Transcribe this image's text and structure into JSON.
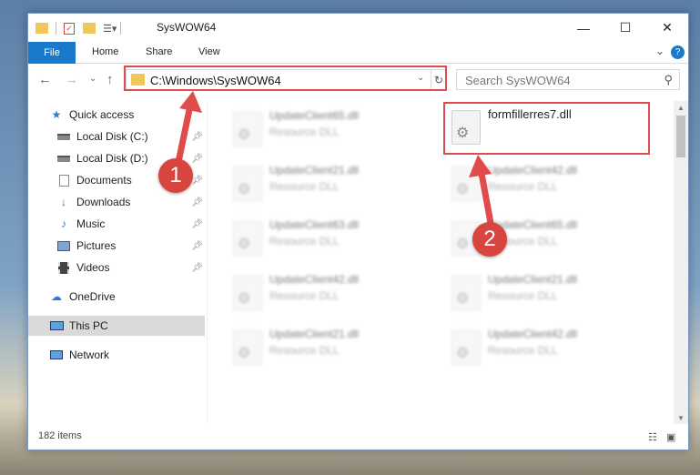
{
  "window": {
    "title": "SysWOW64",
    "minimize": "—",
    "maximize": "☐",
    "close": "✕"
  },
  "ribbon": {
    "tabs": [
      "File",
      "Home",
      "Share",
      "View"
    ],
    "expand": "⌄",
    "help": "?"
  },
  "address": {
    "path": "C:\\Windows\\SysWOW64",
    "back": "←",
    "forward": "→",
    "recent": "⌄",
    "up": "↑",
    "refresh": "↻",
    "dropdown": "⌄"
  },
  "search": {
    "placeholder": "Search SysWOW64",
    "icon": "search-icon"
  },
  "sidebar": {
    "items": [
      {
        "label": "Quick access",
        "icon": "star-icon",
        "pinned": false
      },
      {
        "label": "Local Disk (C:)",
        "icon": "drive-icon",
        "pinned": true
      },
      {
        "label": "Local Disk (D:)",
        "icon": "drive-icon",
        "pinned": true
      },
      {
        "label": "Documents",
        "icon": "documents-icon",
        "pinned": true
      },
      {
        "label": "Downloads",
        "icon": "download-icon",
        "pinned": true
      },
      {
        "label": "Music",
        "icon": "music-icon",
        "pinned": true
      },
      {
        "label": "Pictures",
        "icon": "pictures-icon",
        "pinned": true
      },
      {
        "label": "Videos",
        "icon": "videos-icon",
        "pinned": true
      },
      {
        "label": "OneDrive",
        "icon": "cloud-icon",
        "pinned": false
      },
      {
        "label": "This PC",
        "icon": "monitor-icon",
        "pinned": false,
        "selected": true
      },
      {
        "label": "Network",
        "icon": "network-icon",
        "pinned": false
      }
    ]
  },
  "files": {
    "highlighted": {
      "name": "formfillerres7.dll",
      "type": ""
    },
    "left_column": [
      {
        "name": "UpdateClient65.dll",
        "type": "Resource DLL"
      },
      {
        "name": "UpdateClient21.dll",
        "type": "Resource DLL"
      },
      {
        "name": "UpdateClient63.dll",
        "type": "Resource DLL"
      },
      {
        "name": "UpdateClient42.dll",
        "type": "Resource DLL"
      },
      {
        "name": "UpdateClient21.dll",
        "type": "Resource DLL"
      }
    ],
    "right_column": [
      {
        "name": "UpdateClient42.dll",
        "type": "Resource DLL"
      },
      {
        "name": "UpdateClient65.dll",
        "type": "Resource DLL"
      },
      {
        "name": "UpdateClient21.dll",
        "type": "Resource DLL"
      },
      {
        "name": "UpdateClient42.dll",
        "type": "Resource DLL"
      }
    ]
  },
  "status": {
    "item_count": "182 items"
  },
  "annotations": {
    "step1": "1",
    "step2": "2",
    "color": "#e04b4b"
  }
}
